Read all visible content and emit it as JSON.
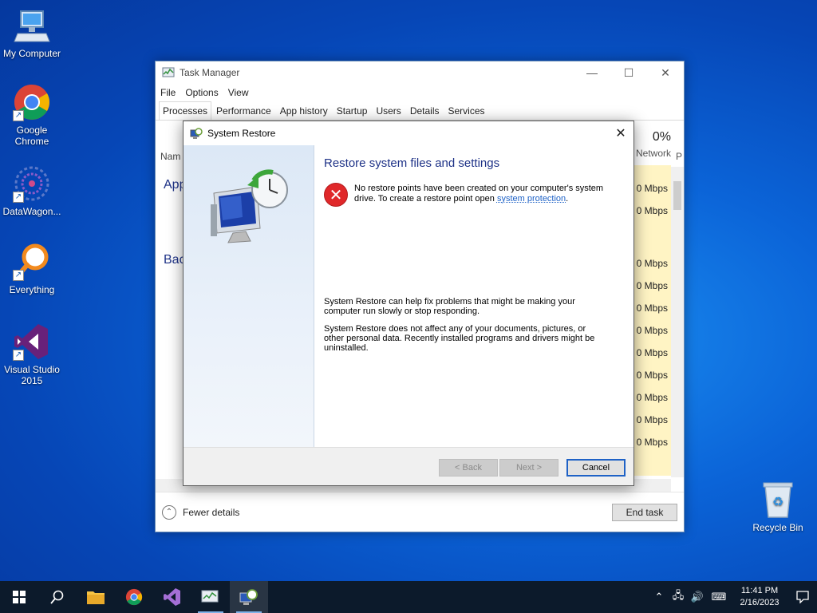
{
  "desktop": {
    "icons": [
      {
        "label": "My Computer"
      },
      {
        "label": "Google Chrome"
      },
      {
        "label": "DataWagon..."
      },
      {
        "label": "Everything"
      },
      {
        "label": "Visual Studio 2015"
      },
      {
        "label": "Recycle Bin"
      }
    ]
  },
  "task_manager": {
    "title": "Task Manager",
    "menu": [
      "File",
      "Options",
      "View"
    ],
    "tabs": [
      "Processes",
      "Performance",
      "App history",
      "Startup",
      "Users",
      "Details",
      "Services"
    ],
    "active_tab": "Processes",
    "name_header_peek": "Nam",
    "apps_section_peek": "App",
    "background_section_peek": "Bac",
    "network_percent": "0%",
    "network_label": "Network",
    "network_values": [
      "0 Mbps",
      "0 Mbps",
      "0 Mbps",
      "0 Mbps",
      "0 Mbps",
      "0 Mbps",
      "0 Mbps",
      "0 Mbps",
      "0 Mbps",
      "0 Mbps",
      "0 Mbps"
    ],
    "next_col_peek": "P",
    "fewer_details": "Fewer details",
    "end_task": "End task"
  },
  "system_restore": {
    "title": "System Restore",
    "heading": "Restore system files and settings",
    "error_line1": "No restore points have been created on your computer's system",
    "error_line2_prefix": "drive. To create a restore point open ",
    "error_link": "system protection",
    "error_line2_suffix": ".",
    "info1_line1": "System Restore can help fix problems that might be making your",
    "info1_line2": "computer run slowly or stop responding.",
    "info2_line1": "System Restore does not affect any of your documents, pictures, or",
    "info2_line2": "other personal data. Recently installed programs and drivers might be",
    "info2_line3": "uninstalled.",
    "back_button": "< Back",
    "next_button": "Next >",
    "cancel_button": "Cancel"
  },
  "taskbar": {
    "clock_time": "11:41 PM",
    "clock_date": "2/16/2023"
  },
  "colors": {
    "heading_blue": "#1e3287",
    "link_blue": "#1e62c7",
    "error_red": "#e0282a",
    "taskbar_bg": "#0c1a2b"
  }
}
